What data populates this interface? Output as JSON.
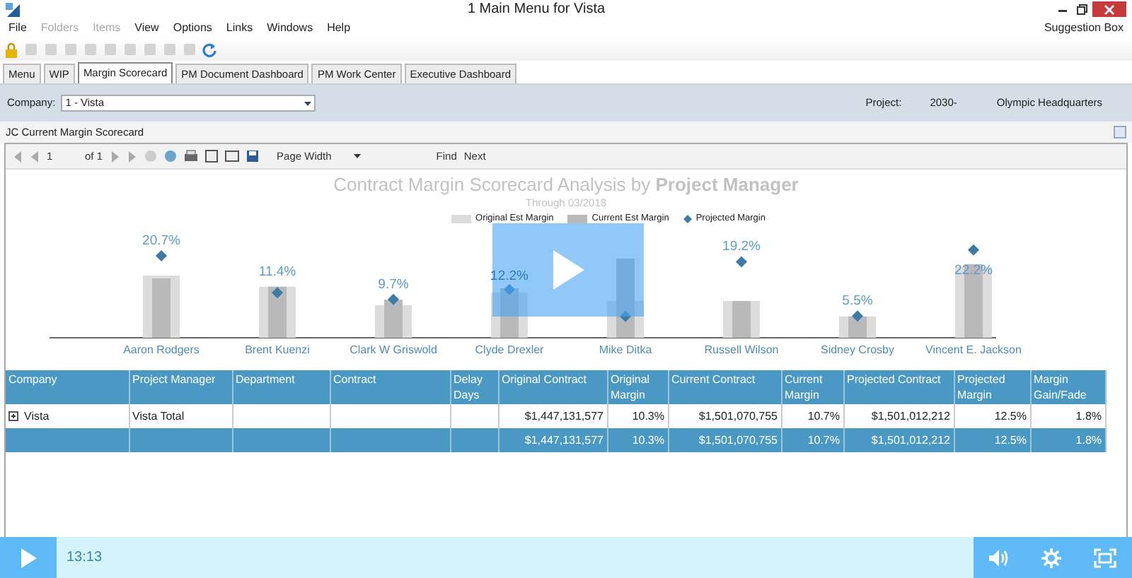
{
  "window": {
    "title": "1 Main Menu for Vista"
  },
  "menu": [
    {
      "label": "File",
      "disabled": false
    },
    {
      "label": "Folders",
      "disabled": true
    },
    {
      "label": "Items",
      "disabled": true
    },
    {
      "label": "View",
      "disabled": false
    },
    {
      "label": "Options",
      "disabled": false
    },
    {
      "label": "Links",
      "disabled": false
    },
    {
      "label": "Windows",
      "disabled": false
    },
    {
      "label": "Help",
      "disabled": false
    }
  ],
  "suggestion_box": "Suggestion Box",
  "tabs": [
    {
      "label": "Menu",
      "selected": false
    },
    {
      "label": "WIP",
      "selected": false
    },
    {
      "label": "Margin Scorecard",
      "selected": true
    },
    {
      "label": "PM Document Dashboard",
      "selected": false
    },
    {
      "label": "PM Work Center",
      "selected": false
    },
    {
      "label": "Executive Dashboard",
      "selected": false
    }
  ],
  "filters": {
    "company_label": "Company:",
    "company_value": "1 - Vista",
    "project_label": "Project:",
    "project_number": "2030-",
    "project_name": "Olympic Headquarters"
  },
  "panel_title": "JC Current Margin Scorecard",
  "report_toolbar": {
    "page": "1",
    "page_of": "of 1",
    "zoom": "Page Width",
    "find": "Find",
    "next": "Next"
  },
  "report": {
    "title": "Contract Margin Scorecard Analysis by **Project Manager**",
    "subtitle": "Through 03/2018",
    "chart": {
      "kind": "bar",
      "categories": [
        {
          "name": "Aaron Rodgers",
          "point_label": "20.7%"
        },
        {
          "name": "Brent Kuenzi",
          "point_label": "11.4%"
        },
        {
          "name": "Clark W Griswold",
          "point_label": "9.7%"
        },
        {
          "name": "Clyde Drexler",
          "point_label": "12.2%"
        },
        {
          "name": "Mike Ditka"
        },
        {
          "name": "Russell Wilson",
          "point_label": "19.2%"
        },
        {
          "name": "Sidney Crosby",
          "point_label": "5.5%"
        },
        {
          "name": "Vincent E. Jackson",
          "point_label": "22.2%"
        }
      ],
      "legend": [
        {
          "name": "Original Est Margin",
          "kind": "bar",
          "color": "#dcdcdc"
        },
        {
          "name": "Current Est Margin",
          "kind": "bar",
          "color": "#b9b9b9"
        },
        {
          "name": "Projected Margin",
          "kind": "point",
          "color": "#3a7ca5"
        }
      ]
    }
  },
  "table": {
    "columns": [
      "Company",
      "Project Manager",
      "Department",
      "Contract",
      "Delay Days",
      "Original Contract",
      "Original Margin",
      "Current Contract",
      "Current Margin",
      "Projected Contract",
      "Projected Margin",
      "Margin Gain/Fade"
    ],
    "rows": [
      {
        "kind": "group",
        "expanded": false,
        "cells": [
          "Vista",
          "Vista Total",
          null,
          null,
          null,
          "$1,447,131,577",
          "10.3%",
          "$1,501,070,755",
          "10.7%",
          "$1,501,012,212",
          "12.5%",
          "1.8%"
        ]
      },
      {
        "kind": "total",
        "cells": [
          null,
          null,
          null,
          null,
          null,
          "$1,447,131,577",
          "10.3%",
          "$1,501,070,755",
          "10.7%",
          "$1,501,012,212",
          "12.5%",
          "1.8%"
        ]
      }
    ]
  },
  "player": {
    "time": "13:13"
  }
}
